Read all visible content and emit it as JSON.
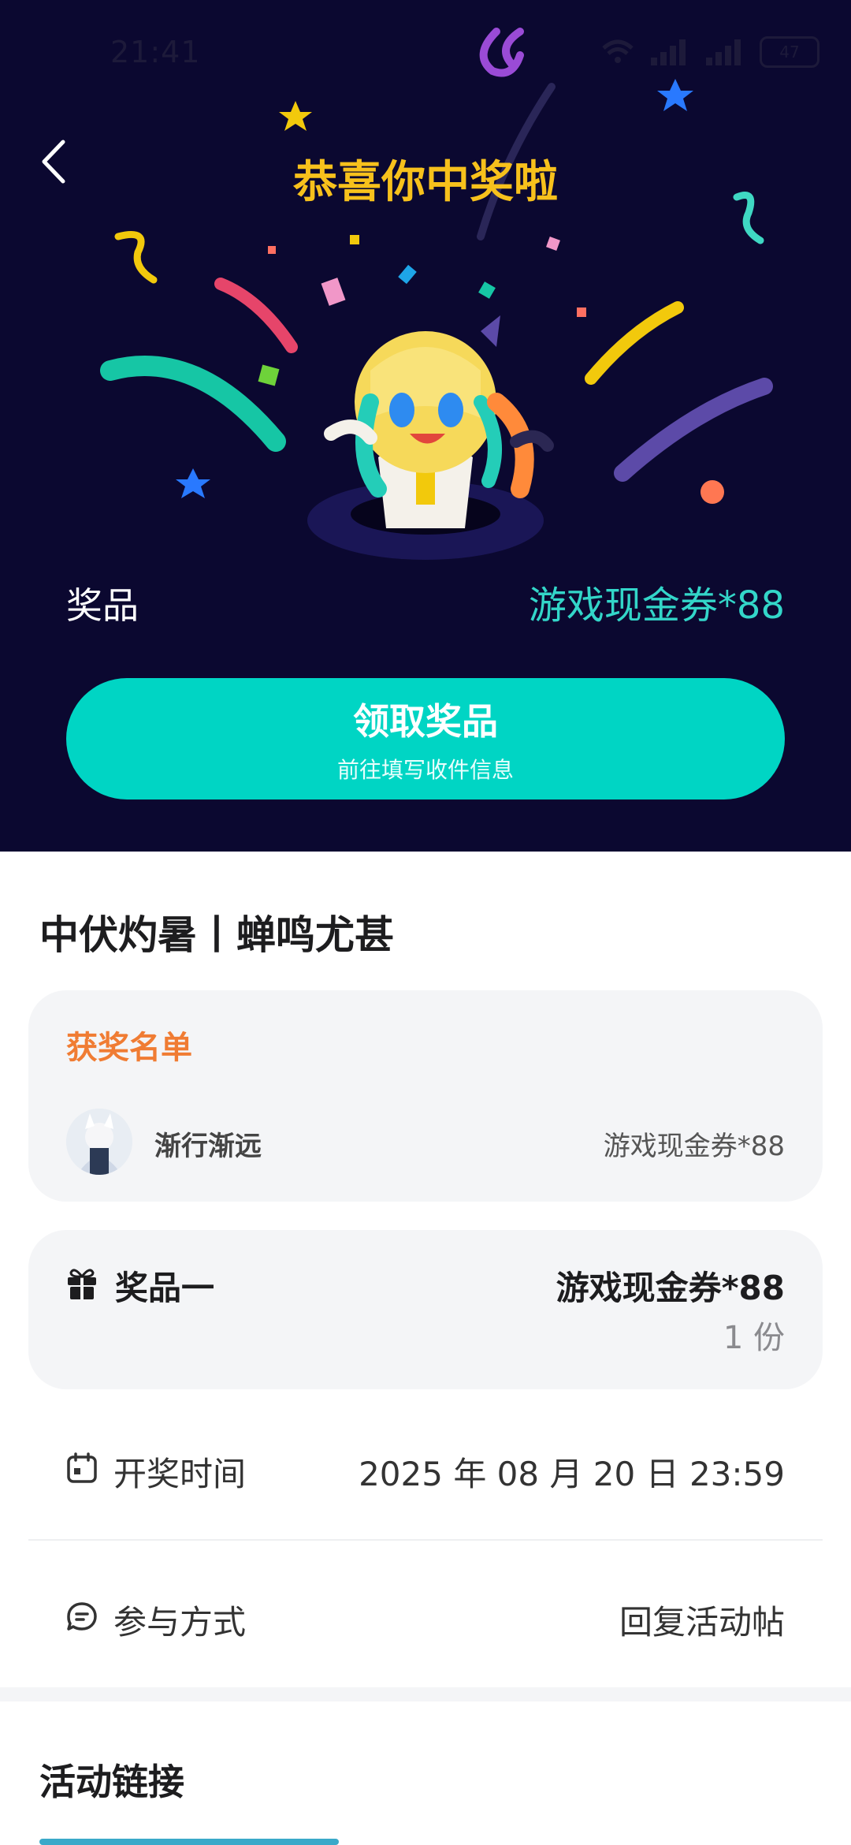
{
  "status_bar": {
    "time": "21:41",
    "battery": "47"
  },
  "header": {
    "title": "恭喜你中奖啦"
  },
  "prize": {
    "label": "奖品",
    "value": "游戏现金券*88"
  },
  "claim_button": {
    "label": "领取奖品",
    "sublabel": "前往填写收件信息"
  },
  "event": {
    "title": "中伏灼暑丨蝉鸣尤甚"
  },
  "winners": {
    "heading": "获奖名单",
    "items": [
      {
        "name": "渐行渐远",
        "prize": "游戏现金券*88"
      }
    ]
  },
  "prize_card": {
    "label": "奖品一",
    "value": "游戏现金券*88",
    "quantity": "1 份"
  },
  "draw_time": {
    "label": "开奖时间",
    "value": "2025 年 08 月 20 日 23:59"
  },
  "participation": {
    "label": "参与方式",
    "value": "回复活动帖"
  },
  "links": {
    "title": "活动链接"
  },
  "colors": {
    "hero_bg": "#0b0830",
    "accent": "#00d5c4",
    "title_gold": "#f7c11c",
    "winners_orange": "#f07c33"
  }
}
